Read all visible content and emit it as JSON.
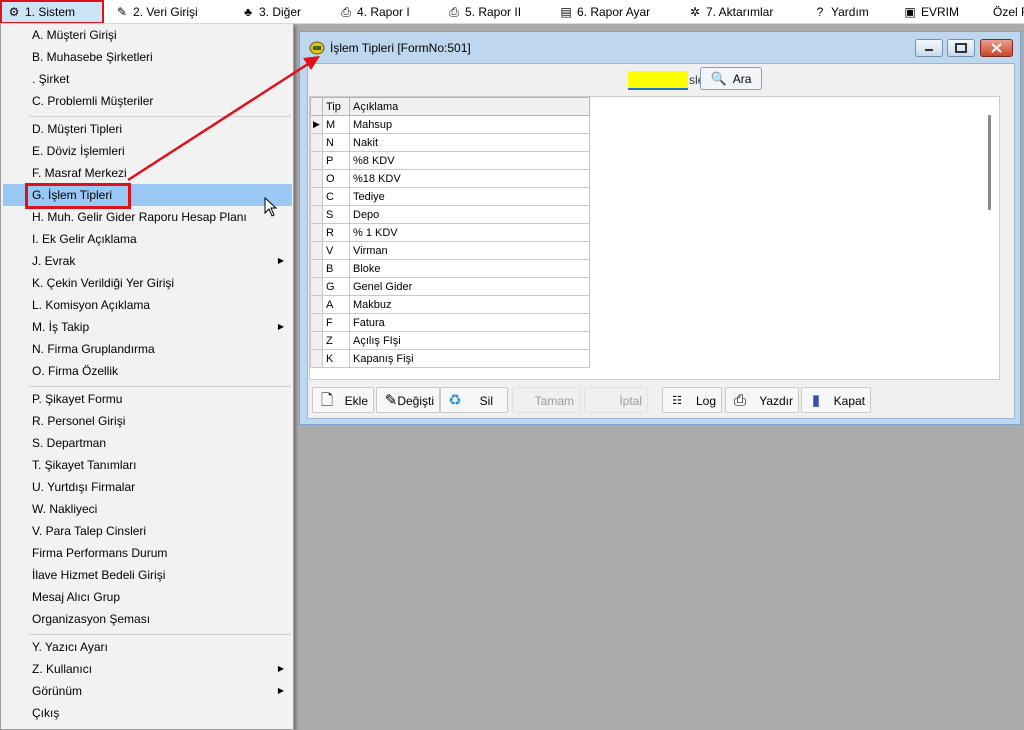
{
  "menubar": {
    "items": [
      {
        "label": "1.  Sistem",
        "icon": "system-icon"
      },
      {
        "label": "2.   Veri Girişi",
        "icon": "data-entry-icon"
      },
      {
        "label": "3.  Diğer",
        "icon": "other-icon"
      },
      {
        "label": "4.   Rapor I",
        "icon": "printer-icon"
      },
      {
        "label": "5.   Rapor II",
        "icon": "printer-icon"
      },
      {
        "label": "6.   Rapor Ayar",
        "icon": "report-settings-icon"
      },
      {
        "label": "7.  Aktarımlar",
        "icon": "transfer-icon"
      },
      {
        "label": "Yardım",
        "icon": "help-icon"
      },
      {
        "label": "EVRIM",
        "icon": "book-icon"
      },
      {
        "label": "Özel F",
        "icon": ""
      }
    ]
  },
  "dropdown": {
    "items": [
      {
        "label": "A.   Müşteri Girişi"
      },
      {
        "label": "B.   Muhasebe Şirketleri"
      },
      {
        "label": "  .   Şirket"
      },
      {
        "label": "C.   Problemli Müşteriler"
      },
      {
        "label": "D.   Müşteri Tipleri"
      },
      {
        "label": "E.   Döviz İşlemleri"
      },
      {
        "label": "F.   Masraf Merkezi"
      },
      {
        "label": "G.   İşlem Tipleri"
      },
      {
        "label": "H.   Muh. Gelir Gider Raporu Hesap Planı"
      },
      {
        "label": "I.   Ek Gelir Açıklama"
      },
      {
        "label": "J.   Evrak"
      },
      {
        "label": "K.   Çekin Verildiği Yer Girişi"
      },
      {
        "label": "L.   Komisyon Açıklama"
      },
      {
        "label": "M.   İş Takip"
      },
      {
        "label": "N.   Firma Gruplandırma"
      },
      {
        "label": "O.  Firma Özellik"
      },
      {
        "label": "P.   Şikayet Formu"
      },
      {
        "label": "R.   Personel Girişi"
      },
      {
        "label": "S.   Departman"
      },
      {
        "label": "T.   Şikayet Tanımları"
      },
      {
        "label": "U.   Yurtdışı Firmalar"
      },
      {
        "label": "W.   Nakliyeci"
      },
      {
        "label": "V.  Para Talep Cinsleri"
      },
      {
        "label": "Firma Performans Durum"
      },
      {
        "label": "İlave Hizmet Bedeli Girişi"
      },
      {
        "label": "Mesaj Alıcı Grup"
      },
      {
        "label": "Organizasyon Şeması"
      },
      {
        "label": "Y.   Yazıcı Ayarı"
      },
      {
        "label": "Z.   Kullanıcı"
      },
      {
        "label": "Görünüm"
      },
      {
        "label": "Çıkış"
      }
    ]
  },
  "window": {
    "title": "İşlem Tipleri [FormNo:501]",
    "search_suffix": "sle",
    "ara_label": "Ara",
    "grid": {
      "headers": [
        "Tip",
        "Açıklama"
      ],
      "rows": [
        [
          "M",
          "Mahsup"
        ],
        [
          "N",
          "Nakit"
        ],
        [
          "P",
          "%8 KDV"
        ],
        [
          "O",
          "%18 KDV"
        ],
        [
          "C",
          "Tediye"
        ],
        [
          "S",
          "Depo"
        ],
        [
          "R",
          "% 1 KDV"
        ],
        [
          "V",
          "Virman"
        ],
        [
          "B",
          "Bloke"
        ],
        [
          "G",
          "Genel Gider"
        ],
        [
          "A",
          "Makbuz"
        ],
        [
          "F",
          "Fatura"
        ],
        [
          "Z",
          "Açılış FIşi"
        ],
        [
          "K",
          "Kapanış Fişi"
        ]
      ]
    },
    "toolbar": {
      "ekle": "Ekle",
      "degistir": "Değişti",
      "sil": "Sil",
      "tamam": "Tamam",
      "iptal": "İptal",
      "log": "Log",
      "yazdir": "Yazdır",
      "kapat": "Kapat"
    }
  },
  "colors": {
    "highlight": "#e0101b",
    "selected_row": "#98c8f3",
    "search_field": "#ffff00",
    "window_frame": "#bfd7ee"
  }
}
